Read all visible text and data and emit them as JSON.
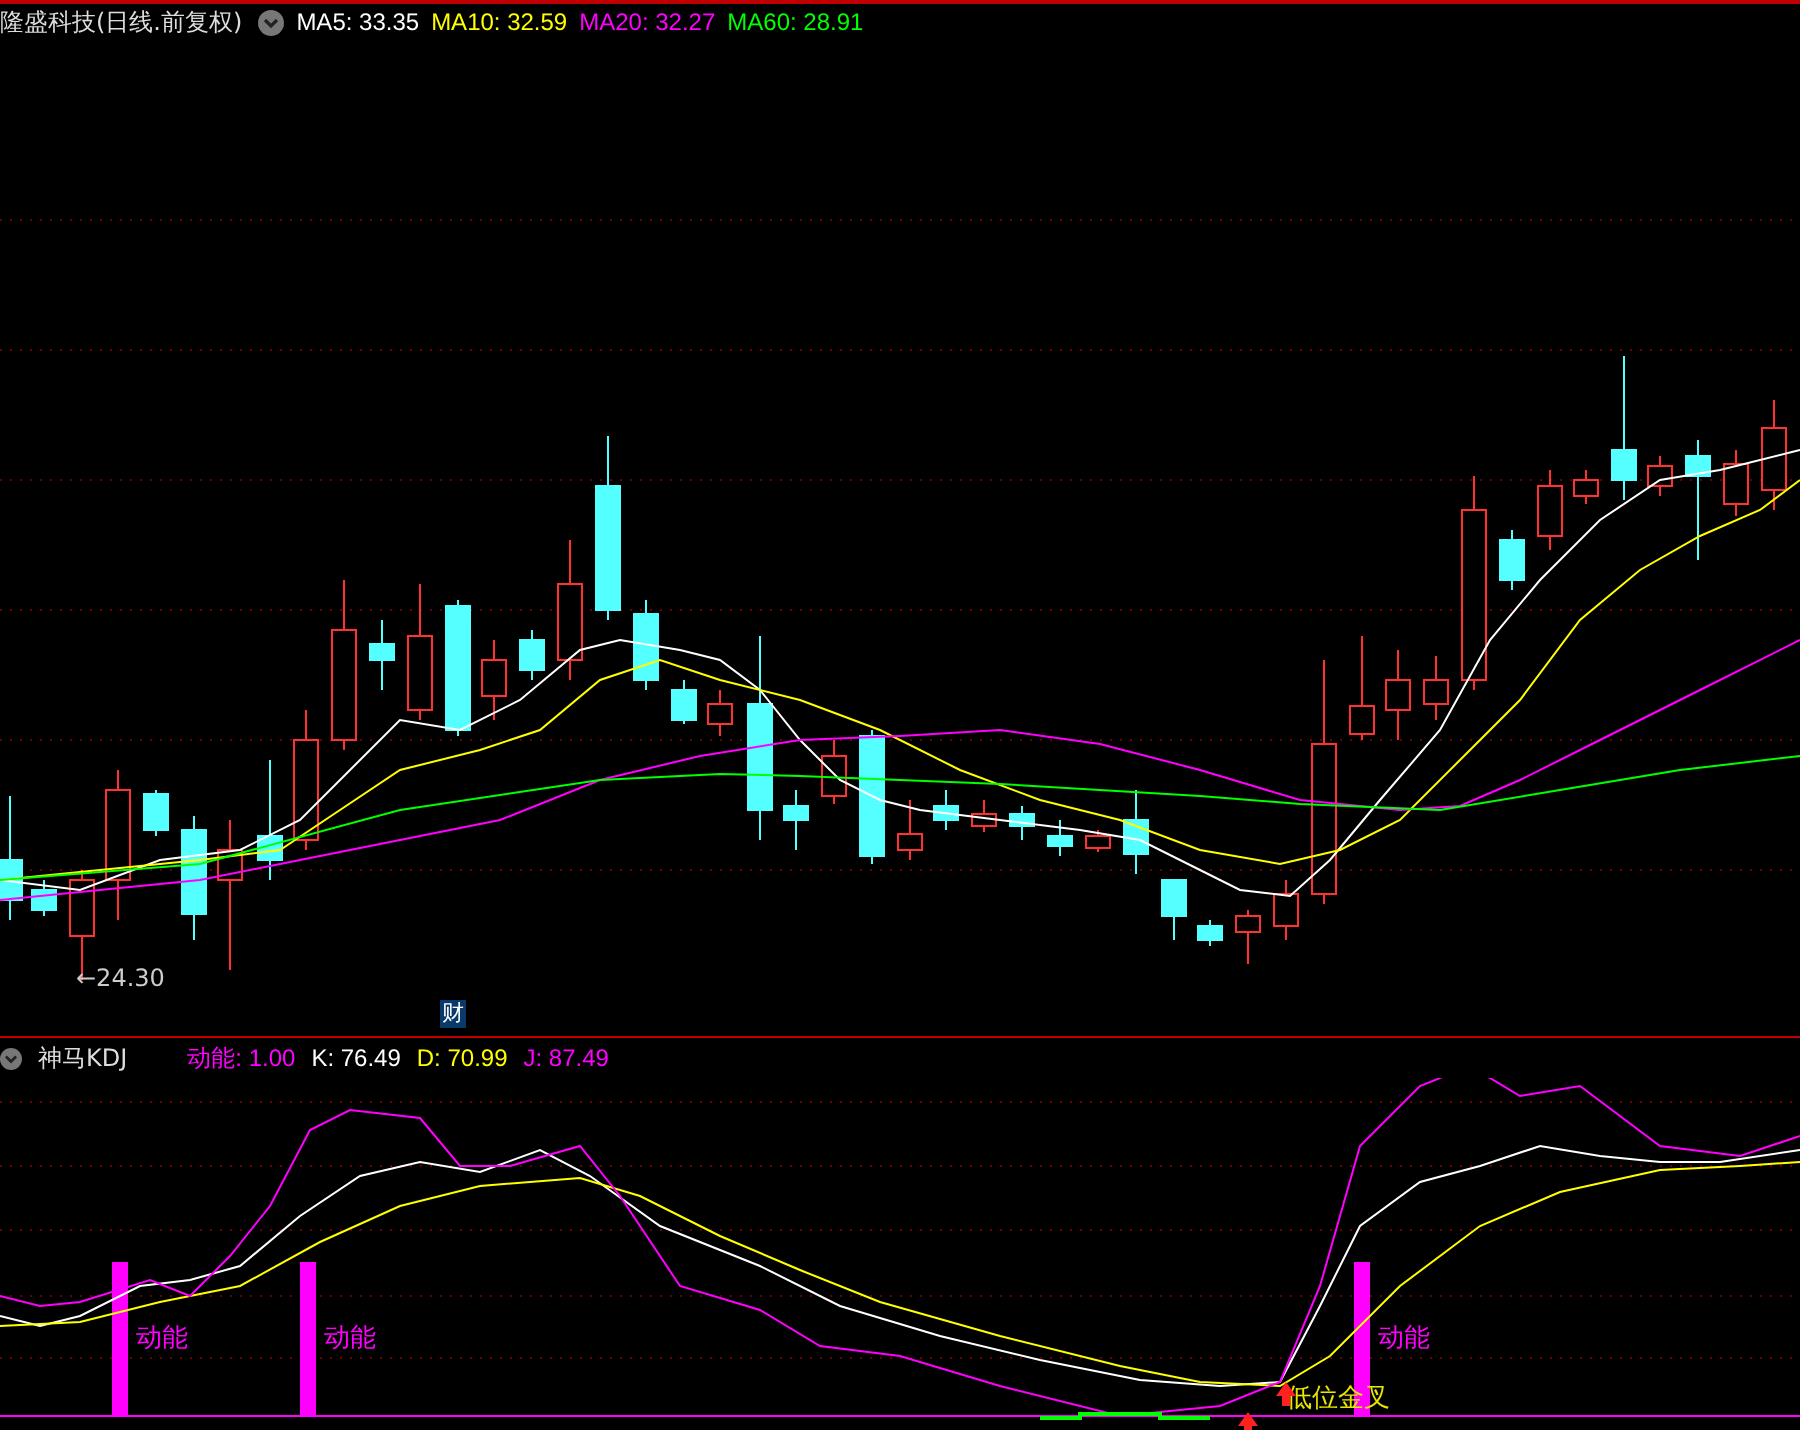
{
  "price_panel": {
    "title": "隆盛科技(日线.前复权)",
    "moving_averages": [
      {
        "label": "MA5: 33.35",
        "color": "#ffffff"
      },
      {
        "label": "MA10: 32.59",
        "color": "#ffff00"
      },
      {
        "label": "MA20: 32.27",
        "color": "#ff00ff"
      },
      {
        "label": "MA60: 28.91",
        "color": "#00ff00"
      }
    ],
    "low_marker": "←24.30",
    "finance_badge": "财"
  },
  "kdj_panel": {
    "title": "神马KDJ",
    "indicators": [
      {
        "label": "动能: 1.00",
        "color": "#ff00ff"
      },
      {
        "label": "K: 76.49",
        "color": "#ffffff"
      },
      {
        "label": "D: 70.99",
        "color": "#ffff00"
      },
      {
        "label": "J: 87.49",
        "color": "#ff00ff"
      }
    ],
    "momentum_labels": [
      "动能",
      "动能",
      "动能"
    ],
    "cross_label": "低位金叉"
  }
}
